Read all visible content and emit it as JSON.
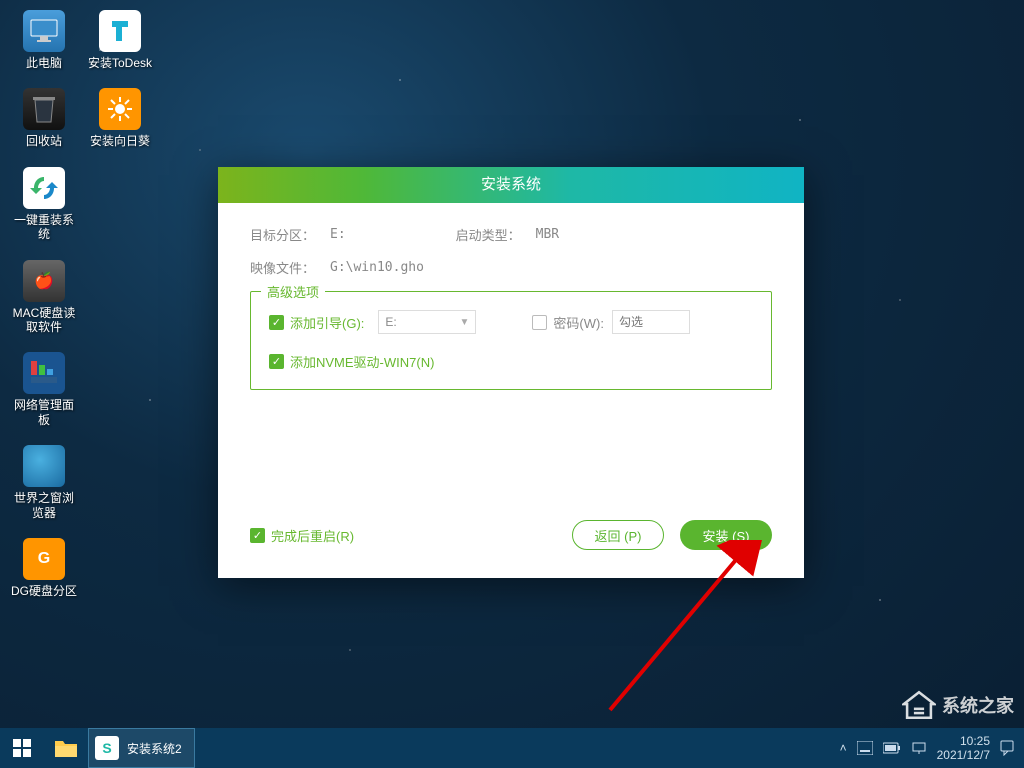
{
  "desktop": {
    "icons": [
      {
        "label": "此电脑",
        "key": "this-pc"
      },
      {
        "label": "安装ToDesk",
        "key": "todesk"
      },
      {
        "label": "回收站",
        "key": "recycle"
      },
      {
        "label": "安装向日葵",
        "key": "sunflower"
      },
      {
        "label": "一键重装系统",
        "key": "reinstall"
      },
      {
        "label": "MAC硬盘读取软件",
        "key": "macread"
      },
      {
        "label": "网络管理面板",
        "key": "netpanel"
      },
      {
        "label": "世界之窗浏览器",
        "key": "theworld"
      },
      {
        "label": "DG硬盘分区",
        "key": "diskgenius"
      }
    ]
  },
  "dialog": {
    "title": "安装系统",
    "target_label": "目标分区：",
    "target_value": "E:",
    "boot_label": "启动类型：",
    "boot_value": "MBR",
    "image_label": "映像文件：",
    "image_value": "G:\\win10.gho",
    "advanced_legend": "高级选项",
    "add_boot_label": "添加引导(G):",
    "add_boot_drive": "E:",
    "password_label": "密码(W):",
    "password_placeholder": "勾选",
    "add_nvme_label": "添加NVME驱动-WIN7(N)",
    "restart_label": "完成后重启(R)",
    "btn_back": "返回 (P)",
    "btn_install": "安装 (S)"
  },
  "watermark": {
    "text": "系统之家"
  },
  "taskbar": {
    "task_label": "安装系统2",
    "time": "10:25",
    "date": "2021/12/7"
  }
}
